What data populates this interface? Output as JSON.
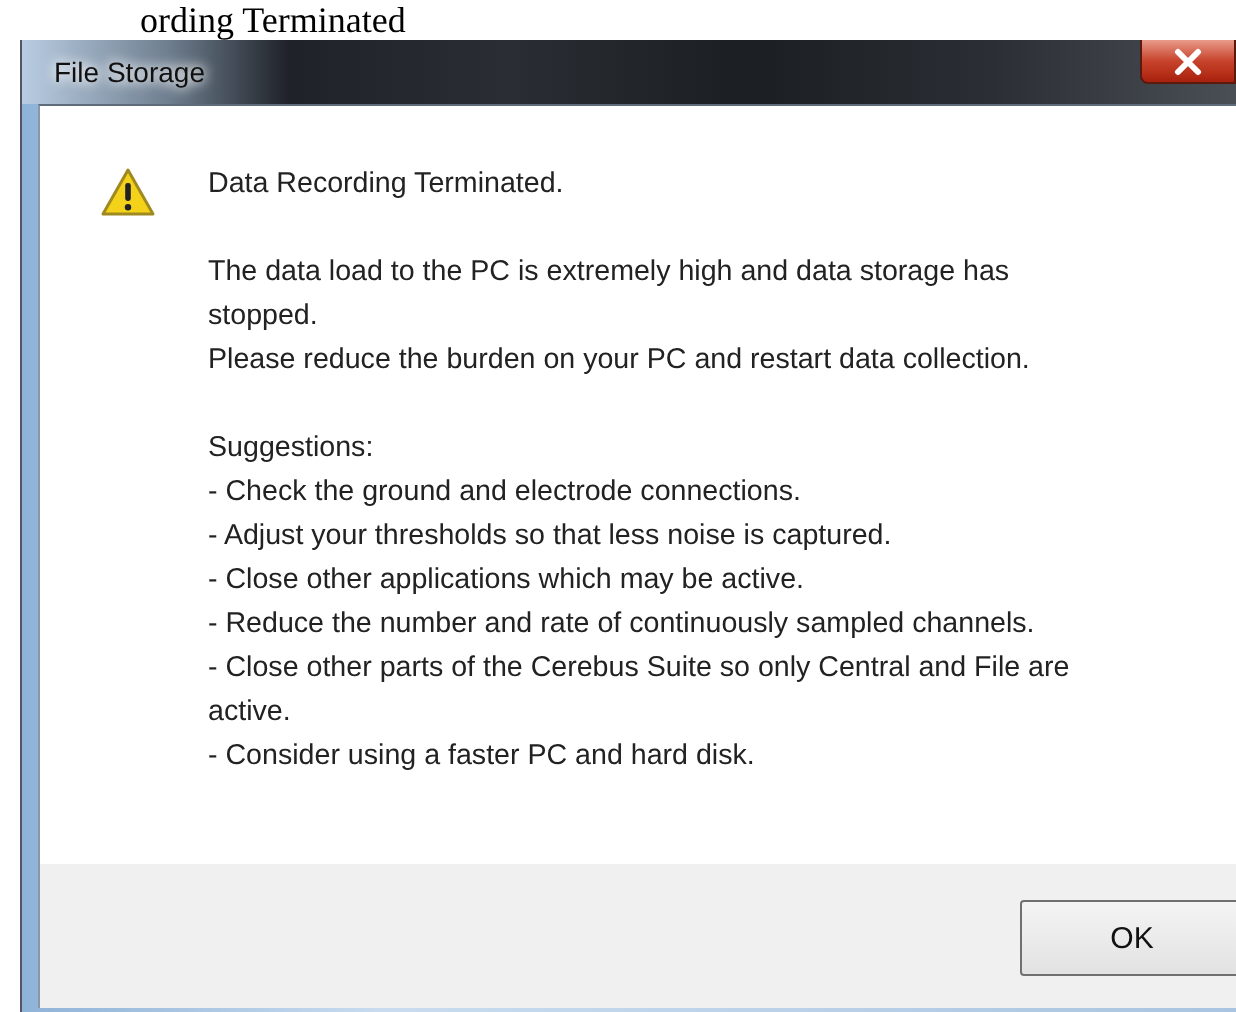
{
  "page_heading": "ording Terminated",
  "window": {
    "title": "File Storage"
  },
  "message": {
    "heading": "Data Recording Terminated.",
    "paragraphs": [
      [
        "The data load to the PC is extremely high and data storage has stopped.",
        "Please reduce the burden on your PC and restart data collection."
      ],
      [
        "Suggestions:",
        " - Check the ground and electrode connections.",
        " - Adjust your thresholds so that less noise is captured.",
        " - Close other applications which may be active.",
        " - Reduce the number and rate of continuously sampled channels.",
        " - Close other parts of the Cerebus Suite so only Central and File are active.",
        " - Consider using a faster PC and hard disk."
      ]
    ]
  },
  "buttons": [
    "OK"
  ]
}
